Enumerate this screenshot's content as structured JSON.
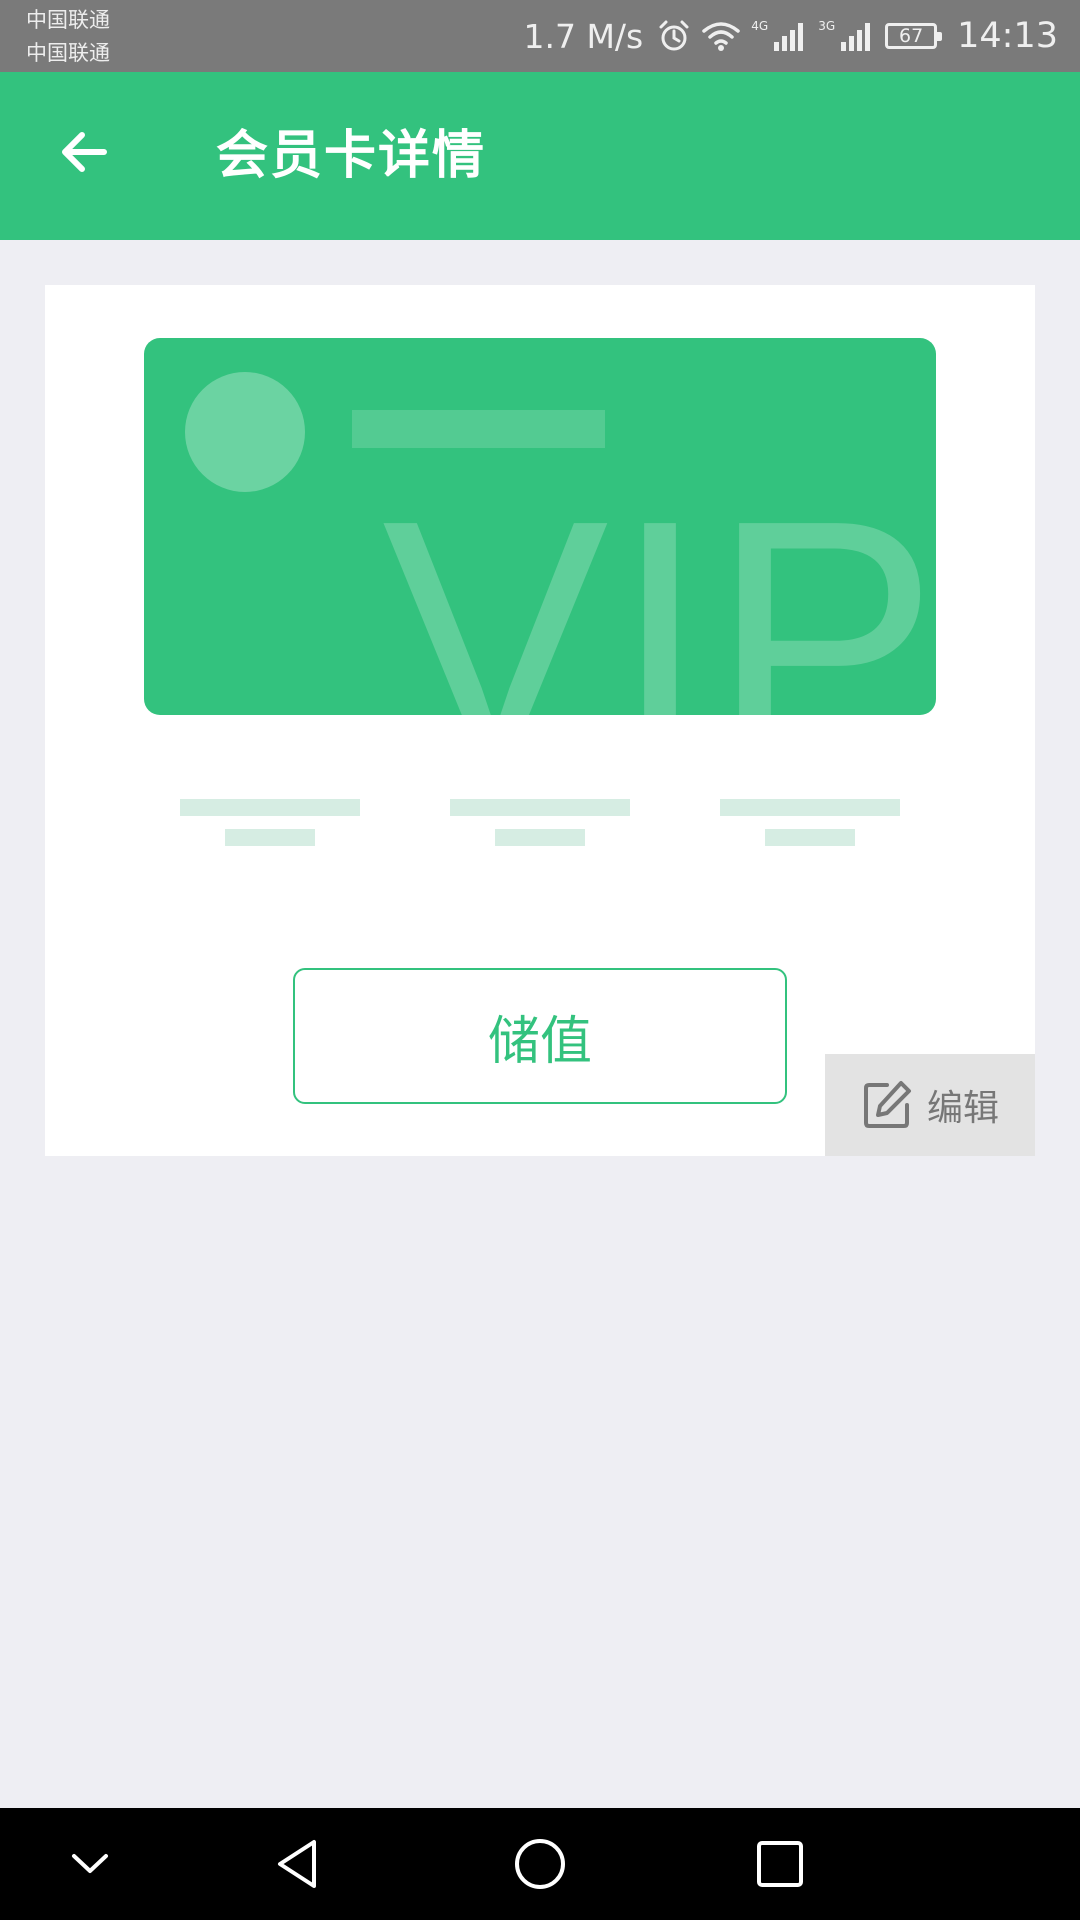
{
  "status_bar": {
    "carrier_1": "中国联通",
    "carrier_2": "中国联通",
    "net_speed": "1.7 M/s",
    "sim1_network": "4G",
    "sim2_network": "3G",
    "battery": "67",
    "time": "14:13",
    "icons": [
      "alarm-icon",
      "wifi-icon",
      "signal-icon",
      "signal-icon",
      "battery-icon"
    ]
  },
  "app_bar": {
    "back_icon": "arrow-left-icon",
    "title": "会员卡详情",
    "color": "#33C27E"
  },
  "card": {
    "label": "VIP",
    "color": "#33C27E"
  },
  "actions": {
    "recharge_label": "储值",
    "edit_label": "编辑",
    "edit_icon": "edit-icon"
  },
  "nav_bar": {
    "icons": [
      "chevron-down-icon",
      "back-triangle-icon",
      "home-circle-icon",
      "recents-square-icon"
    ]
  }
}
